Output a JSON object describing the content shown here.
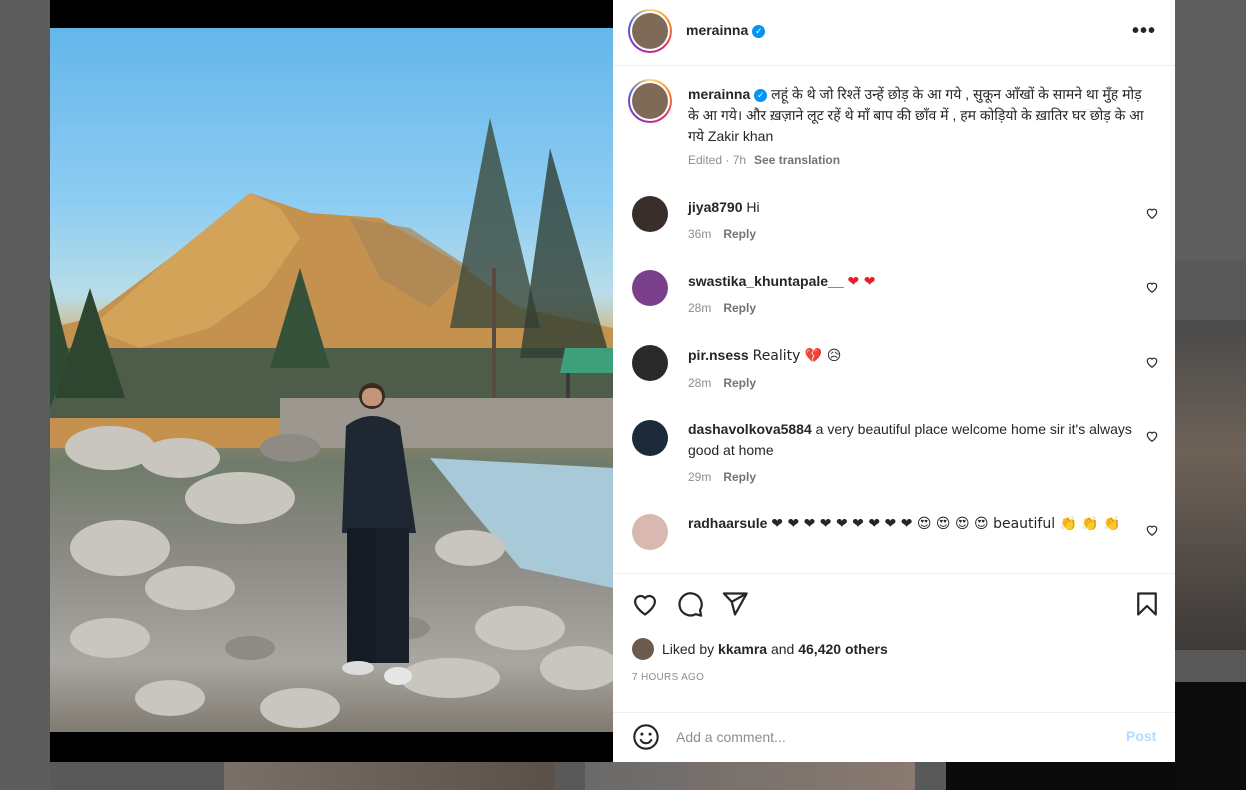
{
  "post": {
    "username": "merainna",
    "verified_mark": "✓",
    "more_icon": "•••",
    "caption": "लहूं के थे जो रिश्तें उन्हें छोड़ के आ गये , सुकून आँखों के सामने था मुँह मोड़ के आ गये। और ख़ज़ाने लूट रहें थे माँ बाप की छाँव में , हम कोड़ियो के ख़ातिर घर छोड़ के आ गये Zakir khan",
    "edited": "Edited · 7h",
    "see_translation": "See translation"
  },
  "comments": [
    {
      "username": "jiya8790",
      "text": "Hi",
      "time": "36m",
      "reply": "Reply",
      "avatar_color": "#3a2e2a"
    },
    {
      "username": "swastika_khuntapale__",
      "text": "❤ ❤",
      "time": "28m",
      "reply": "Reply",
      "avatar_color": "#7a3f8a"
    },
    {
      "username": "pir.nsess",
      "text": "Reality 💔 😥",
      "time": "28m",
      "reply": "Reply",
      "avatar_color": "#2a2a2a"
    },
    {
      "username": "dashavolkova5884",
      "text": "a very beautiful place welcome home sir it's always good at home",
      "time": "29m",
      "reply": "Reply",
      "avatar_color": "#1d2a3a"
    },
    {
      "username": "radhaarsule",
      "text": "❤ ❤ ❤ ❤ ❤ ❤ ❤ ❤ ❤ 😍 😍 😍 😍 beautiful 👏 👏 👏",
      "time": "",
      "reply": "",
      "avatar_color": "#d8b8b0"
    }
  ],
  "likes": {
    "prefix": "Liked by",
    "liker": "kkamra",
    "and": "and",
    "count": "46,420 others"
  },
  "timestamp": "7 HOURS AGO",
  "comment_bar": {
    "placeholder": "Add a comment...",
    "post_label": "Post"
  },
  "colors": {
    "accent": "#0095f6",
    "post_disabled": "#b3dbff",
    "heart_red": "#ed1c24"
  },
  "icons": [
    "like-icon",
    "comment-icon",
    "share-icon",
    "save-icon",
    "emoji-icon",
    "more-icon",
    "verified-icon"
  ]
}
